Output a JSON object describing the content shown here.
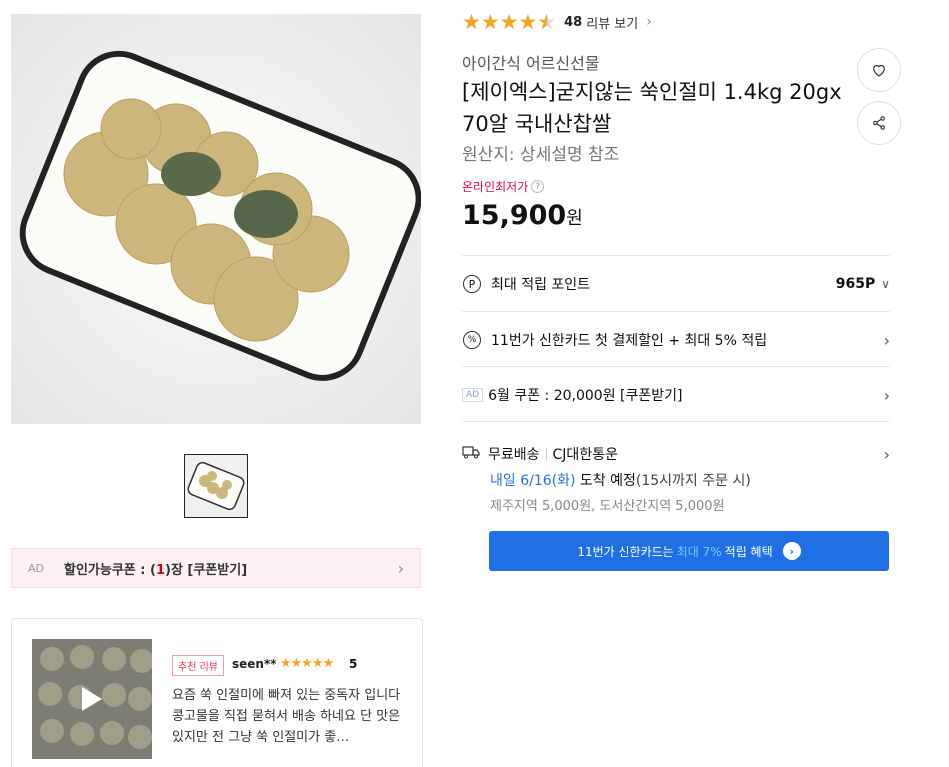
{
  "rating": {
    "value": 4.5,
    "max": 5,
    "count": "48",
    "link_label": "리뷰 보기"
  },
  "product": {
    "seller": "아이간식 어르신선물",
    "title": "[제이엑스]굳지않는 쑥인절미 1.4kg 20gx70알 국내산찹쌀",
    "origin": "원산지:  상세설명 참조",
    "lowest_label": "온라인최저가",
    "price": "15,900",
    "price_unit": "원"
  },
  "actions": {
    "wishlist_icon": "heart-icon",
    "share_icon": "share-icon"
  },
  "benefits": {
    "points_label": "최대 적립 포인트",
    "points_value": "965P",
    "card_discount": "11번가 신한카드 첫 결제할인 + 최대 5% 적립",
    "ad_tag": "AD",
    "coupon_june": "6월 쿠폰 : 20,000원 [쿠폰받기]"
  },
  "shipping": {
    "label": "무료배송",
    "carrier": "CJ대한통운",
    "arrival_date": "내일 6/16(화)",
    "arrival_text": "도착 예정",
    "arrival_note": "(15시까지 주문 시)",
    "extra_fees": "제주지역 5,000원, 도서산간지역 5,000원"
  },
  "card_banner": {
    "prefix": "11번가 신한카드는",
    "highlight": "최대 7%",
    "suffix": "적립 혜택"
  },
  "coupon_bar": {
    "ad": "AD",
    "prefix": "할인가능쿠폰 : (",
    "count": "1",
    "suffix": ")장 [쿠폰받기]"
  },
  "review": {
    "badge": "추천 리뷰",
    "user": "seen**",
    "stars": "★★★★★",
    "score": "5",
    "text": "요즘 쑥 인절미에 빠져 있는 중독자 입니다 콩고물을 직접 묻혀서 배송 하네요 단 맛은 있지만 전 그냥 쑥 인절미가 좋…"
  },
  "colors": {
    "accent": "#1f6fe5",
    "star": "#f5a623",
    "lowest": "#e30b4a",
    "blue_text": "#2b70d8"
  }
}
